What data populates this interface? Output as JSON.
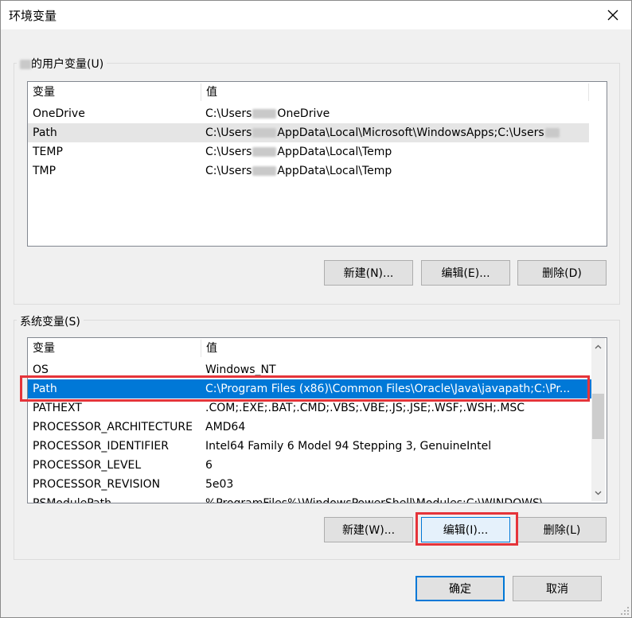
{
  "window": {
    "title": "环境变量",
    "close_icon": "close-icon"
  },
  "user_group": {
    "label_suffix": "的用户变量(U)",
    "columns": [
      "变量",
      "值"
    ],
    "rows": [
      {
        "name": "OneDrive",
        "value_prefix": "C:\\Users",
        "value_suffix": "OneDrive"
      },
      {
        "name": "Path",
        "value_prefix": "C:\\Users",
        "value_suffix": "AppData\\Local\\Microsoft\\WindowsApps;C:\\Users"
      },
      {
        "name": "TEMP",
        "value_prefix": "C:\\Users",
        "value_suffix": "AppData\\Local\\Temp"
      },
      {
        "name": "TMP",
        "value_prefix": "C:\\Users",
        "value_suffix": "AppData\\Local\\Temp"
      }
    ],
    "buttons": {
      "new": "新建(N)...",
      "edit": "编辑(E)...",
      "delete": "删除(D)"
    }
  },
  "system_group": {
    "label": "系统变量(S)",
    "columns": [
      "变量",
      "值"
    ],
    "rows": [
      {
        "name": "OS",
        "value": "Windows_NT"
      },
      {
        "name": "Path",
        "value": "C:\\Program Files (x86)\\Common Files\\Oracle\\Java\\javapath;C:\\Pr..."
      },
      {
        "name": "PATHEXT",
        "value": ".COM;.EXE;.BAT;.CMD;.VBS;.VBE;.JS;.JSE;.WSF;.WSH;.MSC"
      },
      {
        "name": "PROCESSOR_ARCHITECTURE",
        "value": "AMD64"
      },
      {
        "name": "PROCESSOR_IDENTIFIER",
        "value": "Intel64 Family 6 Model 94 Stepping 3, GenuineIntel"
      },
      {
        "name": "PROCESSOR_LEVEL",
        "value": "6"
      },
      {
        "name": "PROCESSOR_REVISION",
        "value": "5e03"
      },
      {
        "name": "PSModulePath",
        "value": "%ProgramFiles%\\WindowsPowerShell\\Modules;C:\\WINDOWS\\..."
      }
    ],
    "selected_row": "Path",
    "buttons": {
      "new": "新建(W)...",
      "edit": "编辑(I)...",
      "delete": "删除(L)"
    }
  },
  "footer": {
    "ok": "确定",
    "cancel": "取消"
  },
  "colors": {
    "selection": "#0078d7",
    "highlight_box": "#e5343a"
  }
}
